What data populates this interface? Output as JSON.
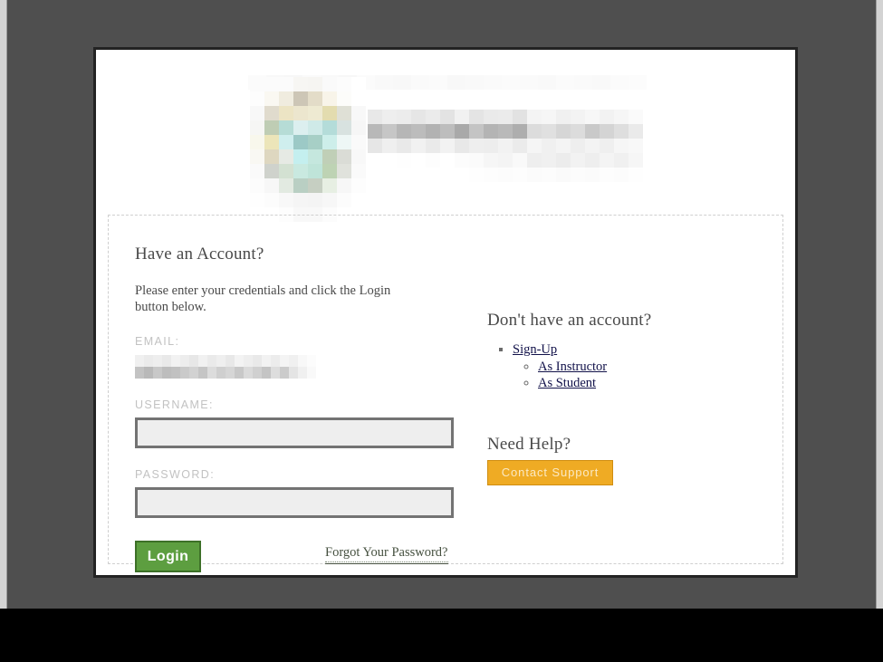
{
  "page": {
    "background_color": "#4f4f4f",
    "panel_background": "#ffffff",
    "panel_border_color": "#232323"
  },
  "masthead": {
    "logo": {
      "name": "organization-logo",
      "state": "pixelated-redacted",
      "block_size": 16,
      "columns": 8,
      "rows": 10,
      "colors": [
        "#fbfbfb",
        "#fbfbfb",
        "#fbfbfb",
        "#f7f6f3",
        "#f6f5f2",
        "#fafafa",
        "#fcfcfc",
        "#ffffff",
        "#fdfdfd",
        "#faf8f2",
        "#f0ecdf",
        "#cdc6b6",
        "#e3dcc8",
        "#f8f4e9",
        "#fcfcfa",
        "#ffffff",
        "#f8f8f8",
        "#e0dbcd",
        "#ece4c4",
        "#ece6ce",
        "#eeead2",
        "#e3dcaf",
        "#dfe0d6",
        "#f8f8f8",
        "#f6f6f4",
        "#bfcdb4",
        "#b6dcd6",
        "#dcefef",
        "#cfeae8",
        "#b4dcd9",
        "#d8e2e0",
        "#f6f6f6",
        "#f8f7ec",
        "#ece5b9",
        "#cfeeee",
        "#9cc9c6",
        "#a7cfc6",
        "#cdeeea",
        "#eef7f6",
        "#fafafa",
        "#f9f8f3",
        "#ded7c0",
        "#e6eae4",
        "#c4efef",
        "#c5e7de",
        "#c0cfb7",
        "#dadcd6",
        "#f8f8f8",
        "#fafafa",
        "#cfd2cc",
        "#d3e1d2",
        "#c9e9e0",
        "#bfe4d9",
        "#bed3b4",
        "#e0e2dc",
        "#fafafa",
        "#fcfcfc",
        "#f7f7f7",
        "#e2eae1",
        "#b9cfc3",
        "#c6cfc2",
        "#e7efe3",
        "#f7f7f7",
        "#fdfdfd",
        "#fefefe",
        "#fcfcfc",
        "#f8f8f8",
        "#f5f5f5",
        "#f4f4f4",
        "#f7f7f7",
        "#fcfcfc",
        "#ffffff",
        "#ffffff",
        "#ffffff",
        "#fdfdfd",
        "#f8f8f8",
        "#f8f8f8",
        "#fcfcfc",
        "#ffffff",
        "#ffffff"
      ]
    },
    "top_strip": {
      "name": "header-top-strip",
      "state": "pixelated-redacted",
      "block_width": 20,
      "block_height": 16,
      "colors": [
        "#fbfbfb",
        "#f8f8f8",
        "#f7f7f7",
        "#fafafa",
        "#f9f9f9",
        "#f7f7f7",
        "#fbfbfb",
        "#f9f9f9",
        "#f8f8f8",
        "#fafafa",
        "#fbfbfb",
        "#f8f8f8",
        "#f9f9f9",
        "#fafafa",
        "#fbfbfb",
        "#fafafa",
        "#f9f9f9",
        "#fbfbfb",
        "#fafafa",
        "#f9f9f9",
        "#fbfbfb",
        "#fcfcfc"
      ]
    },
    "org_name": {
      "name": "organization-name-text",
      "state": "pixelated-redacted",
      "block_size": 16,
      "columns": 19,
      "rows": 5,
      "colors": [
        "#e8e8e8",
        "#eeeeee",
        "#ececec",
        "#e6e6e6",
        "#ebebeb",
        "#e3e3e3",
        "#f1f1f1",
        "#e4e4e4",
        "#eaeaea",
        "#ebebeb",
        "#e2e2e2",
        "#f4f4f4",
        "#f6f6f6",
        "#f0f0f0",
        "#f3f3f3",
        "#f7f7f7",
        "#f2f2f2",
        "#f6f6f6",
        "#fafafa",
        "#b8b8b8",
        "#c6c6c6",
        "#b6b6b6",
        "#bcbcbc",
        "#b2b2b2",
        "#bdbdbd",
        "#a9a9a9",
        "#c4c4c4",
        "#b4b4b4",
        "#b9b9b9",
        "#aeaeae",
        "#dcdcdc",
        "#e0e0e0",
        "#d6d6d6",
        "#dcdcdc",
        "#c9c9c9",
        "#d4d4d4",
        "#dedede",
        "#eaeaea",
        "#e6e6e6",
        "#efefef",
        "#e9e9e9",
        "#f1f1f1",
        "#eaeaea",
        "#f2f2f2",
        "#e8e8e8",
        "#eeeeee",
        "#ededed",
        "#f2f2f2",
        "#ebebeb",
        "#f5f5f5",
        "#f0f0f0",
        "#f4f4f4",
        "#eeeeee",
        "#f3f3f3",
        "#efefef",
        "#f6f6f6",
        "#f8f8f8",
        "#ffffff",
        "#ffffff",
        "#fefefe",
        "#ffffff",
        "#fdfdfd",
        "#ffffff",
        "#fcfcfc",
        "#fbfbfb",
        "#f6f6f6",
        "#f4f4f4",
        "#f9f9f9",
        "#eeeeee",
        "#f0f0f0",
        "#ececec",
        "#f2f2f2",
        "#eeeeee",
        "#f4f4f4",
        "#f0f0f0",
        "#f6f6f6",
        "#ffffff",
        "#ffffff",
        "#ffffff",
        "#ffffff",
        "#ffffff",
        "#ffffff",
        "#ffffff",
        "#fefefe",
        "#fdfdfd",
        "#fcfcfc",
        "#fdfdfd",
        "#fbfbfb",
        "#fcfcfc",
        "#fafafa",
        "#fcfcfc",
        "#fbfbfb",
        "#fdfdfd",
        "#fcfcfc",
        "#fefefe"
      ]
    }
  },
  "login_form": {
    "heading": "Have an Account?",
    "intro_text": "Please enter your credentials and click the Login button below.",
    "email": {
      "label": "EMAIL:",
      "value_state": "pixelated-redacted",
      "value_mosaic": {
        "block_width": 10,
        "block_height": 13,
        "columns": 20,
        "rows": 2,
        "colors": [
          "#f0f0f0",
          "#ebebeb",
          "#eeeeee",
          "#e9e9e9",
          "#f2f2f2",
          "#ededed",
          "#e7e7e7",
          "#f1f1f1",
          "#eaeaea",
          "#efefef",
          "#e8e8e8",
          "#f3f3f3",
          "#eeeeee",
          "#e9e9e9",
          "#f2f2f2",
          "#ececec",
          "#f4f4f4",
          "#f0f0f0",
          "#f8f8f8",
          "#fcfcfc",
          "#c3c3c3",
          "#b9b9b9",
          "#c8c8c8",
          "#bdbdbd",
          "#c1c1c1",
          "#cacaca",
          "#d2d2d2",
          "#c5c5c5",
          "#dcdcdc",
          "#cfcfcf",
          "#d6d6d6",
          "#c8c8c8",
          "#dadada",
          "#d0d0d0",
          "#c4c4c4",
          "#dddddd",
          "#cbcbcb",
          "#e4e4e4",
          "#f0f0f0",
          "#f9f9f9"
        ]
      }
    },
    "username": {
      "label": "USERNAME:",
      "value": "",
      "placeholder": ""
    },
    "password": {
      "label": "PASSWORD:",
      "value": "",
      "placeholder": ""
    },
    "login_button_label": "Login",
    "login_button_color": "#5d9e40",
    "forgot_password_label": "Forgot Your Password?"
  },
  "signup": {
    "heading": "Don't have an account?",
    "primary_link": "Sign-Up",
    "sub_links": [
      "As Instructor",
      "As Student"
    ]
  },
  "help": {
    "heading": "Need Help?",
    "contact_button_label": "Contact Support",
    "contact_button_color": "#efab24"
  }
}
